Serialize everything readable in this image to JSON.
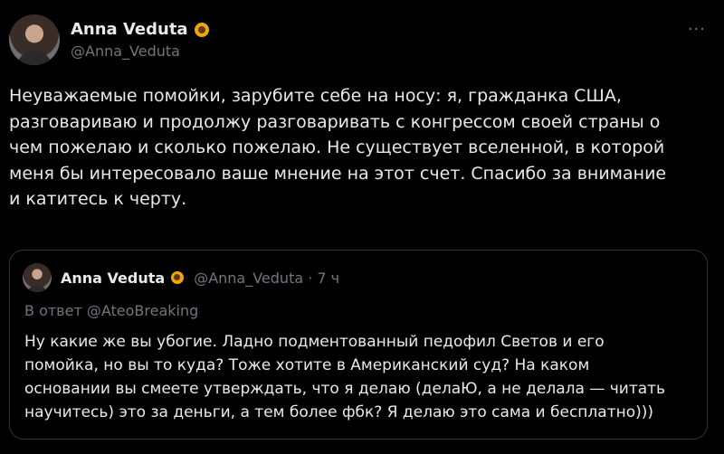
{
  "author": {
    "display_name": "Anna Veduta",
    "handle": "@Anna_Veduta",
    "badge_icon": "sunflower-icon",
    "more_label": "···"
  },
  "tweet": {
    "text": "Неуважаемые помойки, зарубите себе на носу: я, гражданка США,\nразговариваю и продолжу разговаривать с конгрессом своей страны о\nчем пожелаю и сколько пожелаю. Не существует вселенной, в которой\nменя бы интересовало ваше мнение на этот счет. Спасибо за внимание\nи катитесь к черту."
  },
  "quoted_tweet": {
    "display_name": "Anna Veduta",
    "handle_time": "@Anna_Veduta · 7 ч",
    "reply_prefix": "В ответ ",
    "reply_mention": "@AteoBreaking",
    "text": "Ну какие же вы убогие. Ладно подментованный педофил Светов и его\nпомойка, но вы то куда? Тоже хотите в Американский суд? На каком\nосновании вы смеете утверждать, что я делаю (делаЮ, а не делала — читать\nнаучитесь) это за деньги, а тем более фбк? Я делаю это сама и бесплатно)))"
  },
  "colors": {
    "background": "#000000",
    "text": "#e7e9ea",
    "muted": "#71767b",
    "border": "#2f3336"
  }
}
